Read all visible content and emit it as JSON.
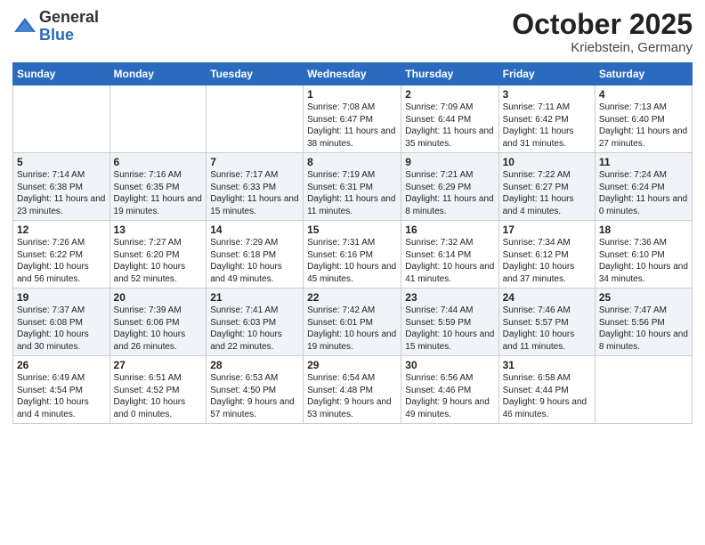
{
  "header": {
    "logo_general": "General",
    "logo_blue": "Blue",
    "month_title": "October 2025",
    "location": "Kriebstein, Germany"
  },
  "days_of_week": [
    "Sunday",
    "Monday",
    "Tuesday",
    "Wednesday",
    "Thursday",
    "Friday",
    "Saturday"
  ],
  "weeks": [
    [
      {
        "day": "",
        "content": ""
      },
      {
        "day": "",
        "content": ""
      },
      {
        "day": "",
        "content": ""
      },
      {
        "day": "1",
        "content": "Sunrise: 7:08 AM\nSunset: 6:47 PM\nDaylight: 11 hours\nand 38 minutes."
      },
      {
        "day": "2",
        "content": "Sunrise: 7:09 AM\nSunset: 6:44 PM\nDaylight: 11 hours\nand 35 minutes."
      },
      {
        "day": "3",
        "content": "Sunrise: 7:11 AM\nSunset: 6:42 PM\nDaylight: 11 hours\nand 31 minutes."
      },
      {
        "day": "4",
        "content": "Sunrise: 7:13 AM\nSunset: 6:40 PM\nDaylight: 11 hours\nand 27 minutes."
      }
    ],
    [
      {
        "day": "5",
        "content": "Sunrise: 7:14 AM\nSunset: 6:38 PM\nDaylight: 11 hours\nand 23 minutes."
      },
      {
        "day": "6",
        "content": "Sunrise: 7:16 AM\nSunset: 6:35 PM\nDaylight: 11 hours\nand 19 minutes."
      },
      {
        "day": "7",
        "content": "Sunrise: 7:17 AM\nSunset: 6:33 PM\nDaylight: 11 hours\nand 15 minutes."
      },
      {
        "day": "8",
        "content": "Sunrise: 7:19 AM\nSunset: 6:31 PM\nDaylight: 11 hours\nand 11 minutes."
      },
      {
        "day": "9",
        "content": "Sunrise: 7:21 AM\nSunset: 6:29 PM\nDaylight: 11 hours\nand 8 minutes."
      },
      {
        "day": "10",
        "content": "Sunrise: 7:22 AM\nSunset: 6:27 PM\nDaylight: 11 hours\nand 4 minutes."
      },
      {
        "day": "11",
        "content": "Sunrise: 7:24 AM\nSunset: 6:24 PM\nDaylight: 11 hours\nand 0 minutes."
      }
    ],
    [
      {
        "day": "12",
        "content": "Sunrise: 7:26 AM\nSunset: 6:22 PM\nDaylight: 10 hours\nand 56 minutes."
      },
      {
        "day": "13",
        "content": "Sunrise: 7:27 AM\nSunset: 6:20 PM\nDaylight: 10 hours\nand 52 minutes."
      },
      {
        "day": "14",
        "content": "Sunrise: 7:29 AM\nSunset: 6:18 PM\nDaylight: 10 hours\nand 49 minutes."
      },
      {
        "day": "15",
        "content": "Sunrise: 7:31 AM\nSunset: 6:16 PM\nDaylight: 10 hours\nand 45 minutes."
      },
      {
        "day": "16",
        "content": "Sunrise: 7:32 AM\nSunset: 6:14 PM\nDaylight: 10 hours\nand 41 minutes."
      },
      {
        "day": "17",
        "content": "Sunrise: 7:34 AM\nSunset: 6:12 PM\nDaylight: 10 hours\nand 37 minutes."
      },
      {
        "day": "18",
        "content": "Sunrise: 7:36 AM\nSunset: 6:10 PM\nDaylight: 10 hours\nand 34 minutes."
      }
    ],
    [
      {
        "day": "19",
        "content": "Sunrise: 7:37 AM\nSunset: 6:08 PM\nDaylight: 10 hours\nand 30 minutes."
      },
      {
        "day": "20",
        "content": "Sunrise: 7:39 AM\nSunset: 6:06 PM\nDaylight: 10 hours\nand 26 minutes."
      },
      {
        "day": "21",
        "content": "Sunrise: 7:41 AM\nSunset: 6:03 PM\nDaylight: 10 hours\nand 22 minutes."
      },
      {
        "day": "22",
        "content": "Sunrise: 7:42 AM\nSunset: 6:01 PM\nDaylight: 10 hours\nand 19 minutes."
      },
      {
        "day": "23",
        "content": "Sunrise: 7:44 AM\nSunset: 5:59 PM\nDaylight: 10 hours\nand 15 minutes."
      },
      {
        "day": "24",
        "content": "Sunrise: 7:46 AM\nSunset: 5:57 PM\nDaylight: 10 hours\nand 11 minutes."
      },
      {
        "day": "25",
        "content": "Sunrise: 7:47 AM\nSunset: 5:56 PM\nDaylight: 10 hours\nand 8 minutes."
      }
    ],
    [
      {
        "day": "26",
        "content": "Sunrise: 6:49 AM\nSunset: 4:54 PM\nDaylight: 10 hours\nand 4 minutes."
      },
      {
        "day": "27",
        "content": "Sunrise: 6:51 AM\nSunset: 4:52 PM\nDaylight: 10 hours\nand 0 minutes."
      },
      {
        "day": "28",
        "content": "Sunrise: 6:53 AM\nSunset: 4:50 PM\nDaylight: 9 hours\nand 57 minutes."
      },
      {
        "day": "29",
        "content": "Sunrise: 6:54 AM\nSunset: 4:48 PM\nDaylight: 9 hours\nand 53 minutes."
      },
      {
        "day": "30",
        "content": "Sunrise: 6:56 AM\nSunset: 4:46 PM\nDaylight: 9 hours\nand 49 minutes."
      },
      {
        "day": "31",
        "content": "Sunrise: 6:58 AM\nSunset: 4:44 PM\nDaylight: 9 hours\nand 46 minutes."
      },
      {
        "day": "",
        "content": ""
      }
    ]
  ]
}
